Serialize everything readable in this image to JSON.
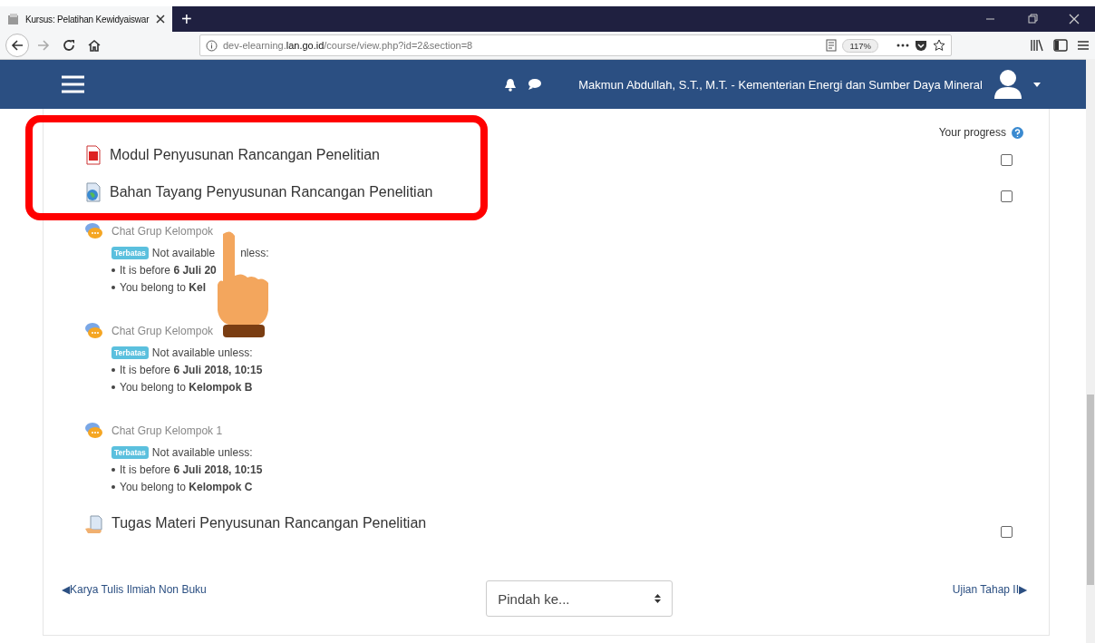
{
  "browser": {
    "tab_title": "Kursus: Pelatihan Kewidyaiswar",
    "new_tab": "+",
    "url_prefix": "dev-elearning.",
    "url_domain": "lan.go.id",
    "url_path": "/course/view.php?id=2&section=8",
    "zoom": "117%"
  },
  "navbar": {
    "user_name": "Makmun Abdullah, S.T., M.T. - Kementerian Energi dan Sumber Daya Mineral"
  },
  "progress_label": "Your progress",
  "activities": [
    {
      "kind": "resource",
      "title": "Modul Penyusunan Rancangan Penelitian",
      "highlighted": true,
      "checked": false
    },
    {
      "kind": "slides",
      "title": "Bahan Tayang Penyusunan Rancangan Penelitian",
      "highlighted": true,
      "checked": false
    },
    {
      "kind": "chat",
      "title": "Chat Grup Kelompok",
      "badge": "Terbatas",
      "restriction": "Not available",
      "restriction_tail": "nless:",
      "conditions": [
        "It is before **6 Juli 20**",
        "You belong to **Kel**"
      ]
    },
    {
      "kind": "chat",
      "title": "Chat Grup Kelompok",
      "badge": "Terbatas",
      "restriction": "Not available unless:",
      "conditions": [
        "It is before **6 Juli 2018, 10:15**",
        "You belong to **Kelompok B**"
      ]
    },
    {
      "kind": "chat",
      "title": "Chat Grup Kelompok 1",
      "badge": "Terbatas",
      "restriction": "Not available unless:",
      "conditions": [
        "It is before **6 Juli 2018, 10:15**",
        "You belong to **Kelompok C**"
      ]
    },
    {
      "kind": "assign",
      "title": "Tugas Materi Penyusunan Rancangan Penelitian",
      "checked": false
    }
  ],
  "section_nav": {
    "previous": "◀Karya Tulis Ilmiah Non Buku",
    "jump_placeholder": "Pindah ke...",
    "next": "Ujian Tahap II▶"
  }
}
